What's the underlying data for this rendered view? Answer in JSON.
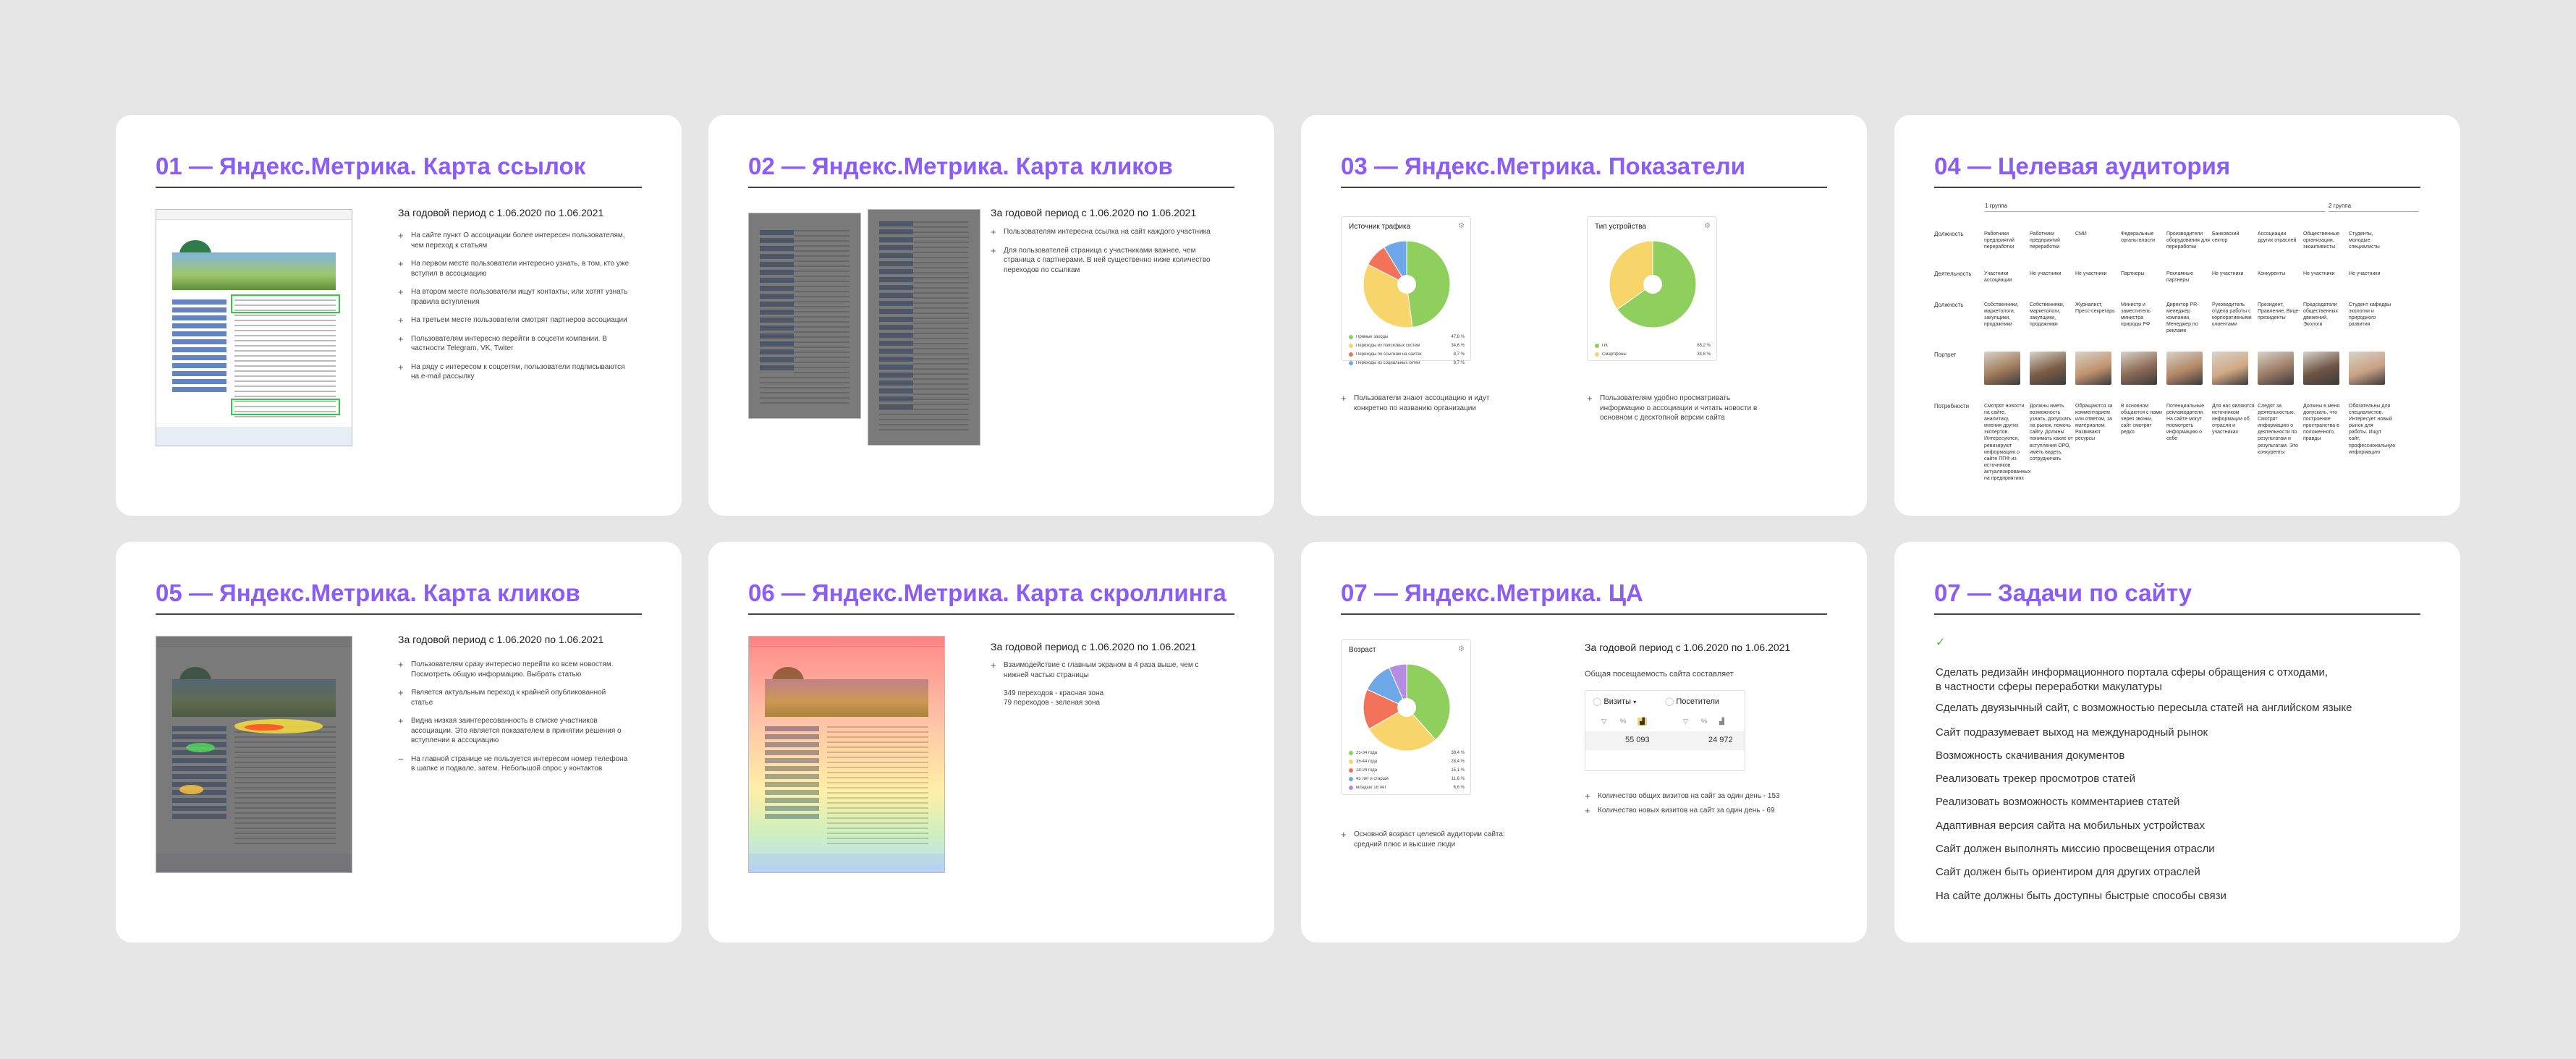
{
  "cards": [
    {
      "title": "01 — Яндекс.Метрика. Карта ссылок",
      "period": "За годовой период с 1.06.2020 по 1.06.2021",
      "bullets": [
        "На сайте пункт О ассоциации более интересен пользователям, чем переход к статьям",
        "На первом месте пользователи интересно узнать, в том, кто уже вступил в ассоциацию",
        "На втором месте пользователи ищут контакты, или хотят узнать правила вступления",
        "На третьем месте пользователи смотрят партнеров ассоциации",
        "Пользователям интересно перейти в соцсети компании. В частности Telegram, VK, Twiter",
        "На ряду с интересом к соцсетям, пользователи подписываются на e-mail рассылку"
      ]
    },
    {
      "title": "02 — Яндекс.Метрика. Карта кликов",
      "period": "За годовой период с 1.06.2020 по 1.06.2021",
      "bullets": [
        "Пользователям интересна ссылка на сайт каждого участника",
        "Для пользователей страница с участниками важнее, чем страница с партнерами. В ней существенно ниже количество переходов по ссылкам"
      ]
    },
    {
      "title": "03 — Яндекс.Метрика. Показатели",
      "widget1": {
        "title": "Источник трафика",
        "legend": [
          {
            "label": "Прямые заходы",
            "value": "47,8 %",
            "color": "#8fcf5e"
          },
          {
            "label": "Переходы из поисковых систем",
            "value": "34,6 %",
            "color": "#f7d56b"
          },
          {
            "label": "Переходы по ссылкам на сайтах",
            "value": "8,7 %",
            "color": "#f2735a"
          },
          {
            "label": "Переходы из социальных сетей",
            "value": "8,7 %",
            "color": "#6fa8e8"
          }
        ],
        "note": "Пользователи знают ассоциацию и идут конкретно по названию организации"
      },
      "widget2": {
        "title": "Тип устройства",
        "legend": [
          {
            "label": "ПК",
            "value": "65,2 %",
            "color": "#8fcf5e"
          },
          {
            "label": "Смартфоны",
            "value": "34,8 %",
            "color": "#f7d56b"
          }
        ],
        "note": "Пользователям удобно просматривать информацию о ассоциации и читать новости в основном с десктопной версии сайта"
      },
      "chart_data": [
        {
          "type": "pie",
          "title": "Источник трафика",
          "categories": [
            "Прямые заходы",
            "Переходы из поисковых систем",
            "Переходы по ссылкам на сайтах",
            "Переходы из социальных сетей"
          ],
          "values": [
            47.8,
            34.6,
            8.7,
            8.7
          ]
        },
        {
          "type": "pie",
          "title": "Тип устройства",
          "categories": [
            "ПК",
            "Смартфоны"
          ],
          "values": [
            65.2,
            34.8
          ]
        }
      ]
    },
    {
      "title": "04 — Целевая аудитория",
      "group1": "1 группа",
      "group2": "2 группа",
      "row_labels": [
        "Должность",
        "Деятельность",
        "Должность",
        "Портрет",
        "Потребности"
      ],
      "columns": [
        {
          "r1": "Работники предприятий переработки",
          "r2": "Участники ассоциации",
          "r3": "Собственники, маркетологи, закупщики, продажники",
          "r5": "Смотрят новости на сайте, аналитику, мнения других экспертов. Интересуются, ревизируют информацию о сайте ППФ из источников актуализированных на предприятиях"
        },
        {
          "r1": "Работники предприятий переработки",
          "r2": "Не участники",
          "r3": "Собственники, маркетологи, закупщики, продажники",
          "r5": "Должны иметь возможность узнать, допускать на рынок, помочь сайту. Должны понимать какие от вступления ОРО, иметь видеть, сотрудничать"
        },
        {
          "r1": "СМИ",
          "r2": "Не участники",
          "r3": "Журналист, Пресс-секретарь",
          "r5": "Обращаются за комментарием или ответом, за материалом. Развивают ресурсы"
        },
        {
          "r1": "Федеральные органы власти",
          "r2": "Партнеры",
          "r3": "Министр и заместитель министра природы РФ",
          "r5": "В основном общаются с нами через звонки, сайт смотрят редко"
        },
        {
          "r1": "Производители оборудования для переработки",
          "r2": "Рекламные партнеры",
          "r3": "Директор PR-менеджер компании, Менеджер по рекламе",
          "r5": "Потенциальные рекламодатели. На сайте могут посмотреть информацию о себе"
        },
        {
          "r1": "Банковский сектор",
          "r2": "Не участники",
          "r3": "Руководитель отдела работы с корпоративными клиентами",
          "r5": "Для нас являются источником информации об отрасли и участниках"
        },
        {
          "r1": "Ассоциации других отраслей",
          "r2": "Конкуренты",
          "r3": "Президент, Правление, Вице-президенты",
          "r5": "Следят за деятельностью. Смотрят информацию о деятельности по результатам и результатам. Это конкуренты"
        },
        {
          "r1": "Общественные организации, экоактивисты",
          "r2": "Не участники",
          "r3": "Председатели общественных движений, Экологи",
          "r5": "Должны в меня допускать, что построение пространства в положенного, правды"
        },
        {
          "r1": "Студенты, молодые специалисты",
          "r2": "Не участники",
          "r3": "Студент кафедры экологии и природного развития",
          "r5": "Обязательны для специалистов. Интересует новый рынок для работы. Ищут сайт, профессиональную информацию"
        }
      ]
    },
    {
      "title": "05 — Яндекс.Метрика. Карта кликов",
      "period": "За годовой период с 1.06.2020 по 1.06.2021",
      "bullets": [
        "Пользователям сразу интересно перейти ко всем новостям. Посмотреть общую информацию. Выбрать статью",
        "Является актуальным переход к крайней опубликованной статье",
        "Видна низкая заинтересованность в списке участников ассоциации. Это является показателем в принятии решения о вступлении в ассоциацию"
      ],
      "minus": "На главной странице не пользуется интересом номер телефона в шапке и подвале, затем. Небольшой спрос у контактов"
    },
    {
      "title": "06 — Яндекс.Метрика. Карта скроллинга",
      "period": "За годовой период с 1.06.2020 по 1.06.2021",
      "bullets": [
        "Взаимодействие с главным экраном в 4 раза выше, чем с нижней частью страницы"
      ],
      "scroll_red": "349 переходов - красная зона",
      "scroll_green": "79 переходов - зеленая зона"
    },
    {
      "title": "07 — Яндекс.Метрика. ЦА",
      "period": "За годовой период с 1.06.2020 по 1.06.2021",
      "visits_caption": "Общая посещаемость сайта составляет",
      "widget": {
        "title": "Возраст",
        "legend": [
          {
            "label": "25-34 года",
            "value": "38,4 %",
            "color": "#8fcf5e"
          },
          {
            "label": "35-44 года",
            "value": "28,4 %",
            "color": "#f7d56b"
          },
          {
            "label": "18-24 года",
            "value": "15,1 %",
            "color": "#f2735a"
          },
          {
            "label": "45 лет и старше",
            "value": "11,6 %",
            "color": "#6fa8e8"
          },
          {
            "label": "младше 18 лет",
            "value": "6,6 %",
            "color": "#b48de3"
          }
        ],
        "note": "Основной возраст целевой аудитории сайта: средний плюс и высшие люди"
      },
      "visits_tab": "Визиты",
      "visitors_tab": "Посетители",
      "visits_value": "55 093",
      "visitors_value": "24 972",
      "stats": [
        "Количество общих визитов на сайт за один день - 153",
        "Количество новых визитов на сайт за один день - 69"
      ],
      "chart_data": {
        "type": "pie",
        "title": "Возраст",
        "categories": [
          "25-34 года",
          "35-44 года",
          "18-24 года",
          "45 лет и старше",
          "младше 18 лет"
        ],
        "values": [
          38.4,
          28.4,
          15.1,
          11.6,
          6.6
        ]
      }
    },
    {
      "title": "07 — Задачи по сайту",
      "check": "✓",
      "tasks": [
        "Сделать редизайн информационного портала сферы обращения с отходами,\nв частности сферы переработки макулатуры",
        "Сделать двуязычный сайт, с возможностью пересыла статей на английском языке",
        "Сайт подразумевает выход на международный рынок",
        "Возможность скачивания документов",
        "Реализовать трекер просмотров статей",
        "Реализовать возможность комментариев статей",
        "Адаптивная версия сайта на мобильных устройствах",
        "Сайт должен выполнять миссию просвещения отрасли",
        "Сайт должен быть ориентиром для других отраслей",
        "На сайте должны быть доступны быстрые способы связи"
      ]
    }
  ]
}
